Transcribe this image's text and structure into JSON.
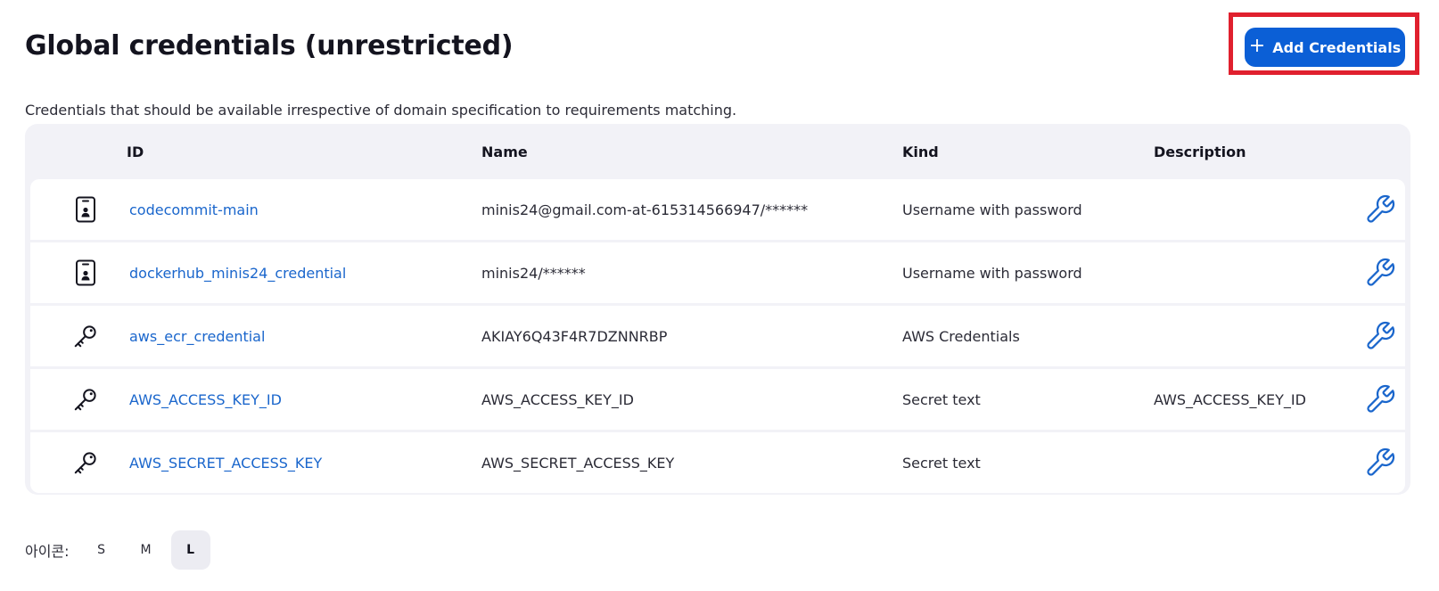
{
  "header": {
    "title": "Global credentials (unrestricted)",
    "add_button_label": "Add Credentials",
    "description": "Credentials that should be available irrespective of domain specification to requirements matching."
  },
  "table": {
    "columns": {
      "id": "ID",
      "name": "Name",
      "kind": "Kind",
      "description": "Description"
    },
    "rows": [
      {
        "icon": "phone-user-icon",
        "id": "codecommit-main",
        "name": "minis24@gmail.com-at-615314566947/******",
        "kind": "Username with password",
        "description": ""
      },
      {
        "icon": "phone-user-icon",
        "id": "dockerhub_minis24_credential",
        "name": "minis24/******",
        "kind": "Username with password",
        "description": ""
      },
      {
        "icon": "key-icon",
        "id": "aws_ecr_credential",
        "name": "AKIAY6Q43F4R7DZNNRBP",
        "kind": "AWS Credentials",
        "description": ""
      },
      {
        "icon": "key-icon",
        "id": "AWS_ACCESS_KEY_ID",
        "name": "AWS_ACCESS_KEY_ID",
        "kind": "Secret text",
        "description": "AWS_ACCESS_KEY_ID"
      },
      {
        "icon": "key-icon",
        "id": "AWS_SECRET_ACCESS_KEY",
        "name": "AWS_SECRET_ACCESS_KEY",
        "kind": "Secret text",
        "description": ""
      }
    ]
  },
  "icon_size": {
    "label": "아이콘:",
    "options": [
      "S",
      "M",
      "L"
    ],
    "selected": "L"
  },
  "colors": {
    "accent": "#0b5fd6",
    "link": "#1a66cc",
    "highlight": "#e0202e"
  }
}
